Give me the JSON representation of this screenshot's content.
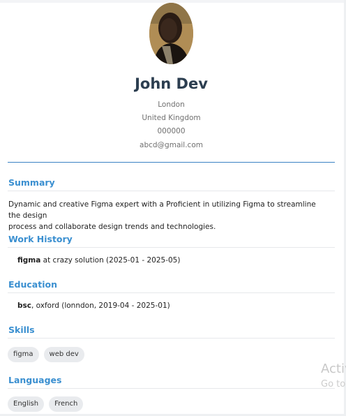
{
  "profile": {
    "name": "John Dev",
    "city": "London",
    "country": "United Kingdom",
    "phone": "000000",
    "email": "abcd@gmail.com"
  },
  "summary": {
    "title": "Summary",
    "line1": "Dynamic and creative Figma expert with a Proficient in utilizing Figma to streamline the design",
    "line2": "process and collaborate design trends and technologies."
  },
  "work_history": {
    "title": "Work History",
    "items": [
      {
        "role": "figma",
        "detail": " at crazy solution (2025-01 - 2025-05)"
      }
    ]
  },
  "education": {
    "title": "Education",
    "items": [
      {
        "degree": "bsc",
        "detail": ", oxford (lonndon, 2019-04 - 2025-01)"
      }
    ]
  },
  "skills": {
    "title": "Skills",
    "items": [
      "figma",
      "web dev"
    ]
  },
  "languages": {
    "title": "Languages",
    "items": [
      "English",
      "French"
    ]
  },
  "watermark": {
    "line1": "Activ",
    "line2": "Go to"
  },
  "colors": {
    "accent": "#3a8fd0",
    "name": "#2c3e50",
    "chip_bg": "#e9ebee"
  }
}
